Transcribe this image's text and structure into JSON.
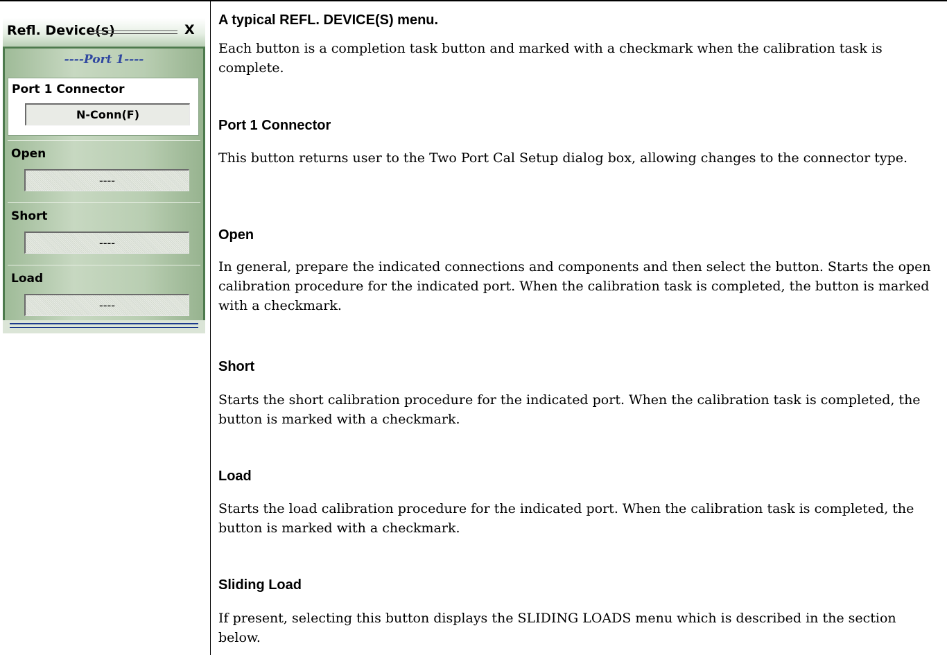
{
  "menu": {
    "title": "Refl. Device(s)",
    "close": "X",
    "port_label": "----Port 1----",
    "buttons": [
      {
        "label": "Port 1 Connector",
        "value": "N-Conn(F)"
      },
      {
        "label": "Open",
        "value": "----"
      },
      {
        "label": "Short",
        "value": "----"
      },
      {
        "label": "Load",
        "value": "----"
      }
    ]
  },
  "doc": {
    "caption": "A typical REFL. DEVICE(S) menu.",
    "intro": "Each button is a completion task button and marked with a checkmark when the calibration task is complete.",
    "sections": [
      {
        "heading": "Port 1 Connector",
        "text": "This button returns user to the Two Port Cal Setup dialog box, allowing changes to the connector type."
      },
      {
        "heading": "Open",
        "text": "In general, prepare the indicated connections and components and then select the button. Starts the open calibration procedure for the indicated port. When the calibration task is completed, the button is marked with a checkmark."
      },
      {
        "heading": "Short",
        "text": "Starts the short calibration procedure for the indicated port. When the calibration task is completed, the button is marked with a checkmark."
      },
      {
        "heading": "Load",
        "text": "Starts the load calibration procedure for the indicated port. When the calibration task is completed, the button is marked with a checkmark."
      },
      {
        "heading": "Sliding Load",
        "text": "If present, selecting this button displays the SLIDING LOADS menu which is described in the section below."
      }
    ]
  }
}
